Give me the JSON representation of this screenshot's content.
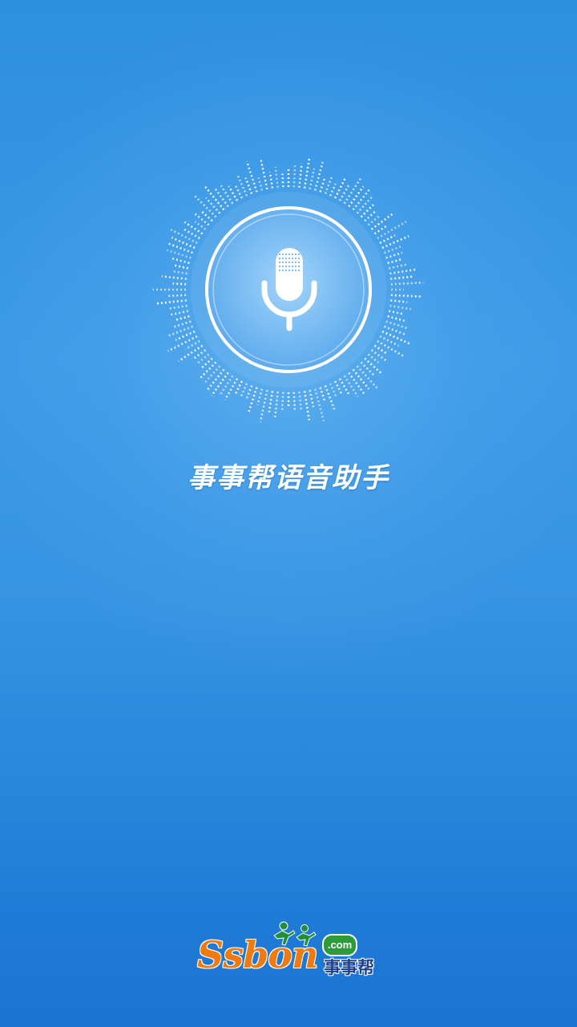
{
  "app": {
    "title": "事事帮语音助手"
  },
  "mic_button": {
    "icon": "microphone-icon"
  },
  "brand": {
    "wordmark": "Ssbon",
    "domain_badge": ".com",
    "chinese_name": "事事帮",
    "logo_icon": "runners-icon"
  },
  "colors": {
    "background_top": "#2d8fe0",
    "background_bottom": "#1a74d2",
    "ring": "#ffffff",
    "brand_orange": "#f07a12",
    "brand_green": "#2e9a3b",
    "brand_navy": "#1b3f8f"
  }
}
